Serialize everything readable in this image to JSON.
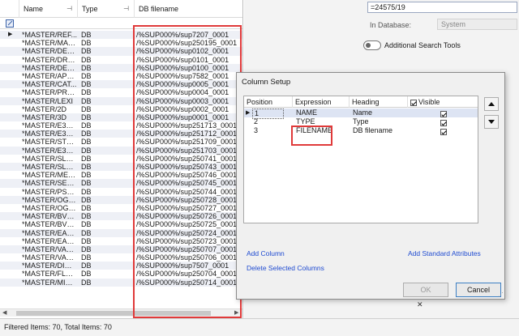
{
  "grid": {
    "headers": {
      "name": "Name",
      "type": "Type",
      "filename": "DB filename"
    },
    "rows": [
      {
        "name": "*MASTER/REF...",
        "type": "DB",
        "file": "/%SUP000%/sup7207_0001",
        "selected": true
      },
      {
        "name": "*MASTER/MAC...",
        "type": "DB",
        "file": "/%SUP000%/sup250195_0001"
      },
      {
        "name": "*MASTER/DESI...",
        "type": "DB",
        "file": "/%SUP000%/sup0102_0001"
      },
      {
        "name": "*MASTER/DRA...",
        "type": "DB",
        "file": "/%SUP000%/sup0101_0001"
      },
      {
        "name": "*MASTER/DESI...",
        "type": "DB",
        "file": "/%SUP000%/sup0100_0001"
      },
      {
        "name": "*MASTER/APS...",
        "type": "DB",
        "file": "/%SUP000%/sup7582_0001"
      },
      {
        "name": "*MASTER/CAT...",
        "type": "DB",
        "file": "/%SUP000%/sup0005_0001"
      },
      {
        "name": "*MASTER/PRO...",
        "type": "DB",
        "file": "/%SUP000%/sup0004_0001"
      },
      {
        "name": "*MASTER/LEXI",
        "type": "DB",
        "file": "/%SUP000%/sup0003_0001"
      },
      {
        "name": "*MASTER/2D",
        "type": "DB",
        "file": "/%SUP000%/sup0002_0001"
      },
      {
        "name": "*MASTER/3D",
        "type": "DB",
        "file": "/%SUP000%/sup0001_0001"
      },
      {
        "name": "*MASTER/E3D...",
        "type": "DB",
        "file": "/%SUP000%/sup251713_0001"
      },
      {
        "name": "*MASTER/E3D...",
        "type": "DB",
        "file": "/%SUP000%/sup251712_0001"
      },
      {
        "name": "*MASTER/STL_...",
        "type": "DB",
        "file": "/%SUP000%/sup251709_0001"
      },
      {
        "name": "*MASTER/E3D...",
        "type": "DB",
        "file": "/%SUP000%/sup251703_0001"
      },
      {
        "name": "*MASTER/SLHI...",
        "type": "DB",
        "file": "/%SUP000%/sup250741_0001"
      },
      {
        "name": "*MASTER/SLHI...",
        "type": "DB",
        "file": "/%SUP000%/sup250743_0001"
      },
      {
        "name": "*MASTER/MEK...",
        "type": "DB",
        "file": "/%SUP000%/sup250746_0001"
      },
      {
        "name": "*MASTER/SE_...",
        "type": "DB",
        "file": "/%SUP000%/sup250745_0001"
      },
      {
        "name": "*MASTER/PSK_...",
        "type": "DB",
        "file": "/%SUP000%/sup250744_0001"
      },
      {
        "name": "*MASTER/OGL...",
        "type": "DB",
        "file": "/%SUP000%/sup250728_0001"
      },
      {
        "name": "*MASTER/OGL...",
        "type": "DB",
        "file": "/%SUP000%/sup250727_0001"
      },
      {
        "name": "*MASTER/BVS-...",
        "type": "DB",
        "file": "/%SUP000%/sup250726_0001"
      },
      {
        "name": "*MASTER/BVS-...",
        "type": "DB",
        "file": "/%SUP000%/sup250725_0001"
      },
      {
        "name": "*MASTER/EAE-...",
        "type": "DB",
        "file": "/%SUP000%/sup250724_0001"
      },
      {
        "name": "*MASTER/EAE-...",
        "type": "DB",
        "file": "/%SUP000%/sup250723_0001"
      },
      {
        "name": "*MASTER/VAN...",
        "type": "DB",
        "file": "/%SUP000%/sup250707_0001"
      },
      {
        "name": "*MASTER/VAN...",
        "type": "DB",
        "file": "/%SUP000%/sup250706_0001"
      },
      {
        "name": "*MASTER/DICT...",
        "type": "DB",
        "file": "/%SUP000%/sup7507_0001"
      },
      {
        "name": "*MASTER/FLEX...",
        "type": "DB",
        "file": "/%SUP000%/sup250704_0001"
      },
      {
        "name": "*MASTER/MINE...",
        "type": "DB",
        "file": "/%SUP000%/sup250714_0001"
      }
    ]
  },
  "status": {
    "text": "Filtered Items: 70, Total Items: 70"
  },
  "search_panel": {
    "search_value": "=24575/19",
    "in_database_label": "In Database:",
    "database_value": "System",
    "additional_tools_label": "Additional Search Tools"
  },
  "dialog": {
    "title": "Column Setup",
    "headers": {
      "position": "Position",
      "expression": "Expression",
      "heading": "Heading",
      "visible": "Visible"
    },
    "rows": [
      {
        "position": "1",
        "expression": "NAME",
        "heading": "Name",
        "visible": true
      },
      {
        "position": "2",
        "expression": "TYPE",
        "heading": "Type",
        "visible": true
      },
      {
        "position": "3",
        "expression": "FILENAME",
        "heading": "DB filename",
        "visible": true
      }
    ],
    "add_column": "Add Column",
    "delete_columns": "Delete Selected Columns",
    "add_standard": "Add Standard Attributes",
    "ok": "OK",
    "cancel": "Cancel"
  },
  "colors": {
    "highlight_box": "#e03a3a",
    "link": "#1f4bd1",
    "row_alt": "#eef0f6"
  }
}
